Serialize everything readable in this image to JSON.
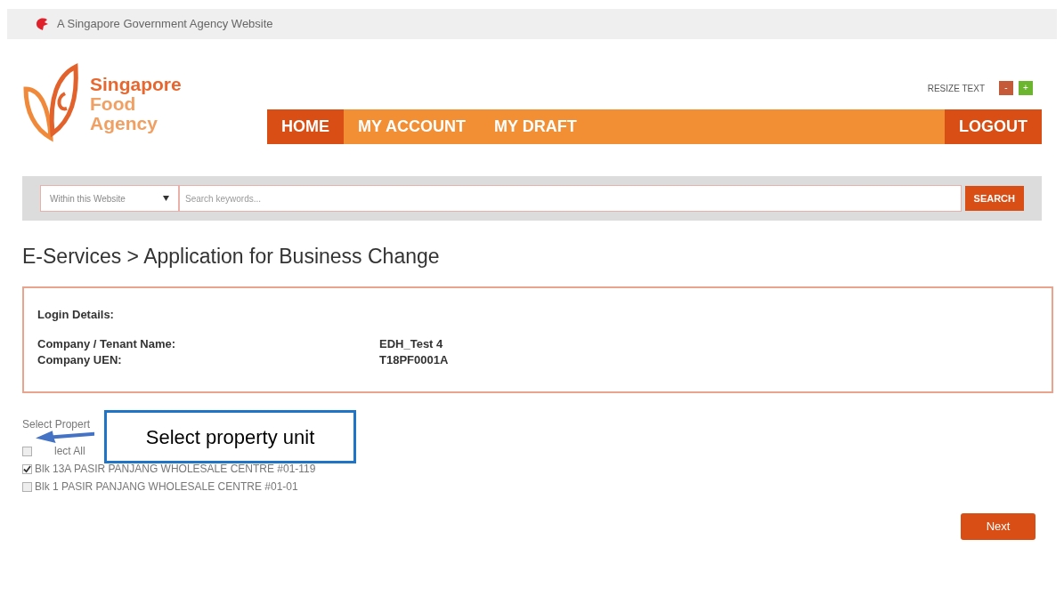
{
  "gov_bar": {
    "text": "A Singapore Government Agency Website"
  },
  "logo": {
    "lines": [
      "Singapore",
      "Food",
      "Agency"
    ]
  },
  "resize_text": {
    "label": "RESIZE TEXT",
    "decrease": "-",
    "increase": "+"
  },
  "nav": [
    {
      "label": "HOME",
      "selected": true
    },
    {
      "label": "MY ACCOUNT",
      "selected": false
    },
    {
      "label": "MY DRAFT",
      "selected": false
    }
  ],
  "logout": "LOGOUT",
  "search": {
    "scope": "Within this Website",
    "placeholder": "Search keywords...",
    "button": "SEARCH"
  },
  "breadcrumb": "E-Services > Application for Business Change",
  "login_details": {
    "title": "Login Details:",
    "rows": [
      {
        "label": "Company / Tenant Name:",
        "value": "EDH_Test 4"
      },
      {
        "label": "Company UEN:",
        "value": "T18PF0001A"
      }
    ]
  },
  "property_section": {
    "label": "Select Propert",
    "options": [
      {
        "label": "lect All",
        "checked": false
      },
      {
        "label": "Blk 13A PASIR PANJANG WHOLESALE CENTRE #01-119",
        "checked": true
      },
      {
        "label": "Blk 1 PASIR PANJANG WHOLESALE CENTRE #01-01",
        "checked": false
      }
    ]
  },
  "callout": "Select property unit",
  "next_button": "Next"
}
